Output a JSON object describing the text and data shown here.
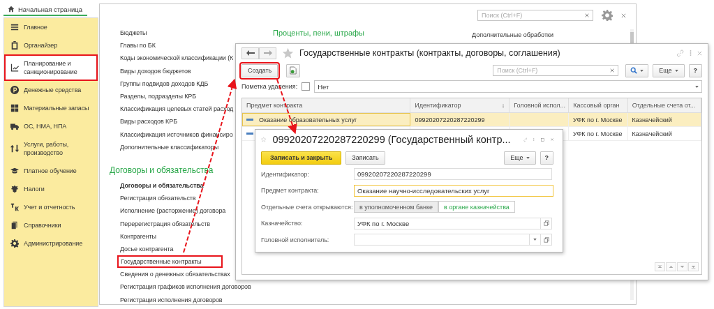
{
  "home_tab": {
    "label": "Начальная страница"
  },
  "sections": [
    {
      "label": "Главное",
      "selected": false,
      "highlighted": false
    },
    {
      "label": "Органайзер",
      "selected": false,
      "highlighted": false
    },
    {
      "label": "Планирование и санкционирование",
      "selected": true,
      "highlighted": true
    },
    {
      "label": "Денежные средства",
      "selected": false,
      "highlighted": false
    },
    {
      "label": "Материальные запасы",
      "selected": false,
      "highlighted": false
    },
    {
      "label": "ОС, НМА, НПА",
      "selected": false,
      "highlighted": false
    },
    {
      "label": "Услуги, работы, производство",
      "selected": false,
      "highlighted": false
    },
    {
      "label": "Платное обучение",
      "selected": false,
      "highlighted": false
    },
    {
      "label": "Налоги",
      "selected": false,
      "highlighted": false
    },
    {
      "label": "Учет и отчетность",
      "selected": false,
      "highlighted": false
    },
    {
      "label": "Справочники",
      "selected": false,
      "highlighted": false
    },
    {
      "label": "Администрирование",
      "selected": false,
      "highlighted": false
    }
  ],
  "main_panel": {
    "search": {
      "placeholder": "Поиск (Ctrl+F)"
    },
    "columns": [
      {
        "groups": [
          {
            "links": [
              {
                "label": "Бюджеты",
                "bold": false,
                "highlighted": false
              },
              {
                "label": "Главы по БК",
                "bold": false,
                "highlighted": false
              },
              {
                "label": "Коды экономической классификации (К",
                "bold": false,
                "highlighted": false
              },
              {
                "label": "Виды доходов бюджетов",
                "bold": false,
                "highlighted": false
              },
              {
                "label": "Группы подвидов доходов КДБ",
                "bold": false,
                "highlighted": false
              },
              {
                "label": "Разделы, подразделы КРБ",
                "bold": false,
                "highlighted": false
              },
              {
                "label": "Классификация целевых статей расход",
                "bold": false,
                "highlighted": false
              },
              {
                "label": "Виды расходов КРБ",
                "bold": false,
                "highlighted": false
              },
              {
                "label": "Классификация источников финансиро",
                "bold": false,
                "highlighted": false
              },
              {
                "label": "Дополнительные классификаторы",
                "bold": false,
                "highlighted": false
              }
            ]
          },
          {
            "heading": "Договоры и обязательства",
            "links": [
              {
                "label": "Договоры и обязательства",
                "bold": true,
                "highlighted": false
              },
              {
                "label": "Регистрация обязательств",
                "bold": false,
                "highlighted": false
              },
              {
                "label": "Исполнение (расторжение) договора",
                "bold": false,
                "highlighted": false
              },
              {
                "label": "Перерегистрация обязательств",
                "bold": false,
                "highlighted": false
              },
              {
                "label": "Контрагенты",
                "bold": false,
                "highlighted": false
              },
              {
                "label": "Досье контрагента",
                "bold": false,
                "highlighted": false
              },
              {
                "label": "Государственные контракты",
                "bold": false,
                "highlighted": true
              },
              {
                "label": "Сведения о денежных обязательствах",
                "bold": false,
                "highlighted": false
              },
              {
                "label": "Регистрация графиков исполнения договоров",
                "bold": false,
                "highlighted": false
              },
              {
                "label": "Регистрация исполнения договоров",
                "bold": false,
                "highlighted": false
              }
            ]
          }
        ]
      },
      {
        "groups": [
          {
            "heading": "Проценты, пени, штрафы"
          }
        ]
      },
      {
        "groups": [
          {
            "links": [
              {
                "label": "Дополнительные обработки",
                "bold": false,
                "highlighted": false
              }
            ]
          }
        ]
      }
    ]
  },
  "list_window": {
    "title": "Государственные контракты (контракты, договоры, соглашения)",
    "create_button": {
      "label": "Создать",
      "highlighted": true
    },
    "search": {
      "placeholder": "Поиск (Ctrl+F)"
    },
    "more_button": "Еще",
    "help_button": "?",
    "filter": {
      "label": "Пометка удаления:",
      "checked": false,
      "value": "Нет"
    },
    "table": {
      "columns": [
        {
          "label": "Предмет контракта"
        },
        {
          "label": "Идентификатор",
          "sort": "↓"
        },
        {
          "label": "Головной испол..."
        },
        {
          "label": "Кассовый орган"
        },
        {
          "label": "Отдельные счета от..."
        }
      ],
      "rows": [
        {
          "selected": true,
          "cells": [
            "Оказание образовательных услуг",
            "09920207220287220299",
            null,
            "УФК по г. Москве",
            "Казначейский"
          ]
        },
        {
          "selected": false,
          "cells": [
            null,
            null,
            null,
            "УФК по г. Москве",
            "Казначейский"
          ]
        }
      ]
    }
  },
  "form_window": {
    "title": "09920207220287220299 (Государственный контр...",
    "save_close_button": "Записать и закрыть",
    "save_button": "Записать",
    "more_button": "Еще",
    "help_button": "?",
    "fields": [
      {
        "kind": "text",
        "label": "Идентификатор:",
        "value": "09920207220287220299",
        "focused": false
      },
      {
        "kind": "text",
        "label": "Предмет контракта:",
        "value": "Оказание научно-исследовательских услуг",
        "focused": true
      },
      {
        "kind": "toggle",
        "label": "Отдельные счета открываются:",
        "options": [
          {
            "label": "в уполномоченном банке",
            "selected": false
          },
          {
            "label": "в органе казначейства",
            "selected": true
          }
        ]
      },
      {
        "kind": "reference",
        "label": "Казначейство:",
        "value": "УФК по г. Москве",
        "focused": false
      },
      {
        "kind": "dropdown",
        "label": "Головной исполнитель:",
        "focused": false
      }
    ]
  }
}
